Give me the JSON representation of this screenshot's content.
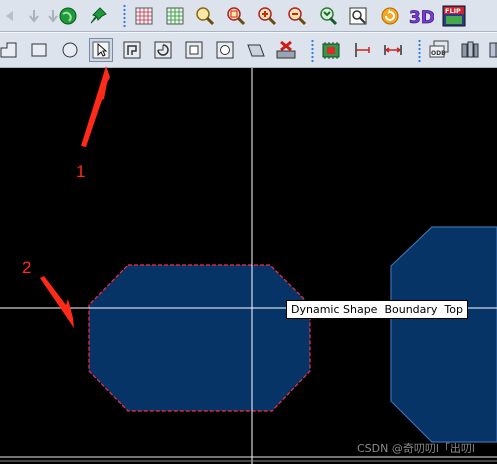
{
  "toolbar_row1": {
    "icons": [
      "undo-icon",
      "redo-icon",
      "down-arrow-icon",
      "globe-icon",
      "pin-icon",
      "grid-icon",
      "grid-alt-icon",
      "zoom-fit-icon",
      "zoom-icon",
      "zoom-in-icon",
      "zoom-out-icon",
      "zoom-previous-icon",
      "zoom-world-icon",
      "refresh-icon",
      "3d-view-icon",
      "flip-icon"
    ],
    "view_3d_label": "3D",
    "flip_label": "FLIP"
  },
  "toolbar_row2": {
    "icons": [
      "shape-poly-icon",
      "shape-rect-icon",
      "shape-circle-icon",
      "select-shape-icon",
      "shape-voids-icon",
      "shape-circle-void-icon",
      "shape-rect-void-icon",
      "shape-ellipse-void-icon",
      "shape-edit-icon",
      "shape-delete-icon",
      "component-icon",
      "dimension-icon",
      "measure-icon",
      "odb-export-icon",
      "layers-icon",
      "book-icon"
    ],
    "odb_label": "ODB"
  },
  "canvas": {
    "tooltip": "Dynamic Shape  Boundary  Top",
    "annotation_1": "1",
    "annotation_2": "2",
    "shape_fill": "#063466",
    "shape_outline": "#ff2a4a",
    "other_shape_outline": "#3b6fb0",
    "crosshair_color": "#ffffff",
    "arrow_color": "#ff2a1a"
  },
  "watermark": "CSDN @奇叨叨l「出叨l"
}
